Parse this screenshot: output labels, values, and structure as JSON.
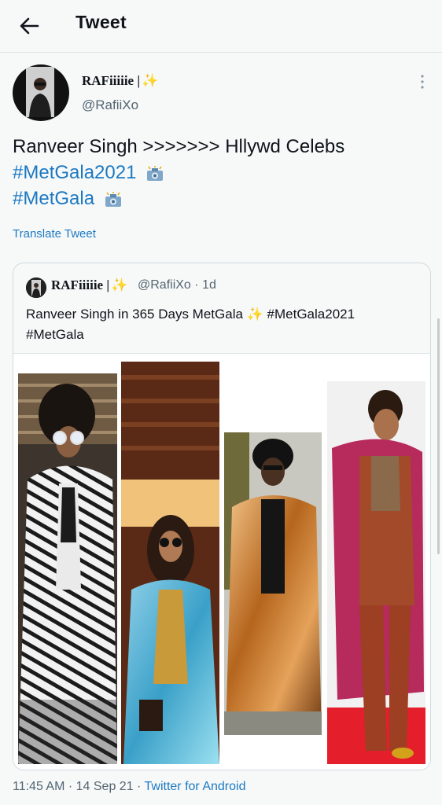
{
  "header": {
    "title": "Tweet",
    "back_icon": "arrow-left-icon"
  },
  "tweet": {
    "author_name": "RAFiiiiie |",
    "author_emoji": "✨",
    "author_handle": "@RafiiXo",
    "text_line1": "Ranveer Singh >>>>>>> Hllywd Celebs",
    "hashtag1": "#MetGala2021",
    "hashtag2": "#MetGala",
    "translate_label": "Translate Tweet",
    "timestamp": "11:45 AM · 14 Sep 21 · ",
    "source": "Twitter for Android"
  },
  "quoted_tweet": {
    "author_name": "RAFiiiiie |",
    "author_emoji": "✨",
    "handle_time": "@RafiiXo · 1d",
    "text_line1": "Ranveer Singh in 365 Days MetGala ✨ #MetGala2021",
    "text_line2": "#MetGala"
  },
  "colors": {
    "link": "#1d79c2",
    "secondary_text": "#536471",
    "background": "#f7f9f9"
  }
}
